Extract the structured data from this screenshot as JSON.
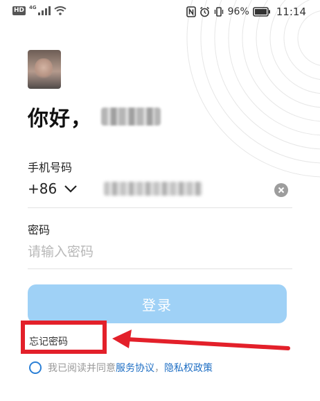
{
  "status_bar": {
    "hd": "HD",
    "network": "4G",
    "battery": "96%",
    "time": "11:14"
  },
  "greeting": {
    "hello": "你好",
    "comma": "，"
  },
  "phone": {
    "label": "手机号码",
    "country_code": "+86"
  },
  "password": {
    "label": "密码",
    "placeholder": "请输入密码"
  },
  "login_button": "登录",
  "forgot_password": "忘记密码",
  "agreement": {
    "prefix": "我已阅读并同意",
    "service": "服务协议",
    "separator": "，",
    "privacy": "隐私权政策"
  },
  "colors": {
    "login_button": "#9fd1f6",
    "link": "#1f6fc4",
    "annotation": "#e3202a"
  }
}
